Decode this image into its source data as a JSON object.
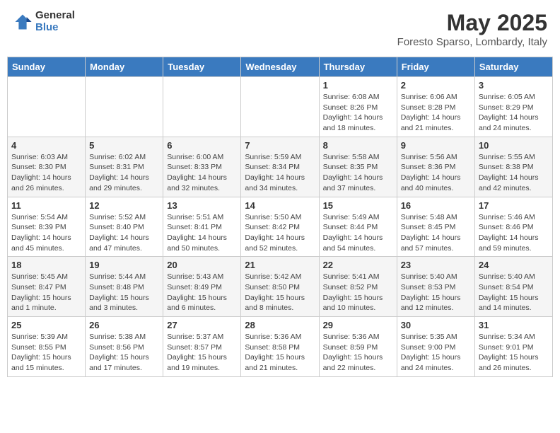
{
  "header": {
    "logo_general": "General",
    "logo_blue": "Blue",
    "main_title": "May 2025",
    "subtitle": "Foresto Sparso, Lombardy, Italy"
  },
  "weekdays": [
    "Sunday",
    "Monday",
    "Tuesday",
    "Wednesday",
    "Thursday",
    "Friday",
    "Saturday"
  ],
  "weeks": [
    [
      {
        "day": "",
        "info": ""
      },
      {
        "day": "",
        "info": ""
      },
      {
        "day": "",
        "info": ""
      },
      {
        "day": "",
        "info": ""
      },
      {
        "day": "1",
        "info": "Sunrise: 6:08 AM\nSunset: 8:26 PM\nDaylight: 14 hours\nand 18 minutes."
      },
      {
        "day": "2",
        "info": "Sunrise: 6:06 AM\nSunset: 8:28 PM\nDaylight: 14 hours\nand 21 minutes."
      },
      {
        "day": "3",
        "info": "Sunrise: 6:05 AM\nSunset: 8:29 PM\nDaylight: 14 hours\nand 24 minutes."
      }
    ],
    [
      {
        "day": "4",
        "info": "Sunrise: 6:03 AM\nSunset: 8:30 PM\nDaylight: 14 hours\nand 26 minutes."
      },
      {
        "day": "5",
        "info": "Sunrise: 6:02 AM\nSunset: 8:31 PM\nDaylight: 14 hours\nand 29 minutes."
      },
      {
        "day": "6",
        "info": "Sunrise: 6:00 AM\nSunset: 8:33 PM\nDaylight: 14 hours\nand 32 minutes."
      },
      {
        "day": "7",
        "info": "Sunrise: 5:59 AM\nSunset: 8:34 PM\nDaylight: 14 hours\nand 34 minutes."
      },
      {
        "day": "8",
        "info": "Sunrise: 5:58 AM\nSunset: 8:35 PM\nDaylight: 14 hours\nand 37 minutes."
      },
      {
        "day": "9",
        "info": "Sunrise: 5:56 AM\nSunset: 8:36 PM\nDaylight: 14 hours\nand 40 minutes."
      },
      {
        "day": "10",
        "info": "Sunrise: 5:55 AM\nSunset: 8:38 PM\nDaylight: 14 hours\nand 42 minutes."
      }
    ],
    [
      {
        "day": "11",
        "info": "Sunrise: 5:54 AM\nSunset: 8:39 PM\nDaylight: 14 hours\nand 45 minutes."
      },
      {
        "day": "12",
        "info": "Sunrise: 5:52 AM\nSunset: 8:40 PM\nDaylight: 14 hours\nand 47 minutes."
      },
      {
        "day": "13",
        "info": "Sunrise: 5:51 AM\nSunset: 8:41 PM\nDaylight: 14 hours\nand 50 minutes."
      },
      {
        "day": "14",
        "info": "Sunrise: 5:50 AM\nSunset: 8:42 PM\nDaylight: 14 hours\nand 52 minutes."
      },
      {
        "day": "15",
        "info": "Sunrise: 5:49 AM\nSunset: 8:44 PM\nDaylight: 14 hours\nand 54 minutes."
      },
      {
        "day": "16",
        "info": "Sunrise: 5:48 AM\nSunset: 8:45 PM\nDaylight: 14 hours\nand 57 minutes."
      },
      {
        "day": "17",
        "info": "Sunrise: 5:46 AM\nSunset: 8:46 PM\nDaylight: 14 hours\nand 59 minutes."
      }
    ],
    [
      {
        "day": "18",
        "info": "Sunrise: 5:45 AM\nSunset: 8:47 PM\nDaylight: 15 hours\nand 1 minute."
      },
      {
        "day": "19",
        "info": "Sunrise: 5:44 AM\nSunset: 8:48 PM\nDaylight: 15 hours\nand 3 minutes."
      },
      {
        "day": "20",
        "info": "Sunrise: 5:43 AM\nSunset: 8:49 PM\nDaylight: 15 hours\nand 6 minutes."
      },
      {
        "day": "21",
        "info": "Sunrise: 5:42 AM\nSunset: 8:50 PM\nDaylight: 15 hours\nand 8 minutes."
      },
      {
        "day": "22",
        "info": "Sunrise: 5:41 AM\nSunset: 8:52 PM\nDaylight: 15 hours\nand 10 minutes."
      },
      {
        "day": "23",
        "info": "Sunrise: 5:40 AM\nSunset: 8:53 PM\nDaylight: 15 hours\nand 12 minutes."
      },
      {
        "day": "24",
        "info": "Sunrise: 5:40 AM\nSunset: 8:54 PM\nDaylight: 15 hours\nand 14 minutes."
      }
    ],
    [
      {
        "day": "25",
        "info": "Sunrise: 5:39 AM\nSunset: 8:55 PM\nDaylight: 15 hours\nand 15 minutes."
      },
      {
        "day": "26",
        "info": "Sunrise: 5:38 AM\nSunset: 8:56 PM\nDaylight: 15 hours\nand 17 minutes."
      },
      {
        "day": "27",
        "info": "Sunrise: 5:37 AM\nSunset: 8:57 PM\nDaylight: 15 hours\nand 19 minutes."
      },
      {
        "day": "28",
        "info": "Sunrise: 5:36 AM\nSunset: 8:58 PM\nDaylight: 15 hours\nand 21 minutes."
      },
      {
        "day": "29",
        "info": "Sunrise: 5:36 AM\nSunset: 8:59 PM\nDaylight: 15 hours\nand 22 minutes."
      },
      {
        "day": "30",
        "info": "Sunrise: 5:35 AM\nSunset: 9:00 PM\nDaylight: 15 hours\nand 24 minutes."
      },
      {
        "day": "31",
        "info": "Sunrise: 5:34 AM\nSunset: 9:01 PM\nDaylight: 15 hours\nand 26 minutes."
      }
    ]
  ]
}
